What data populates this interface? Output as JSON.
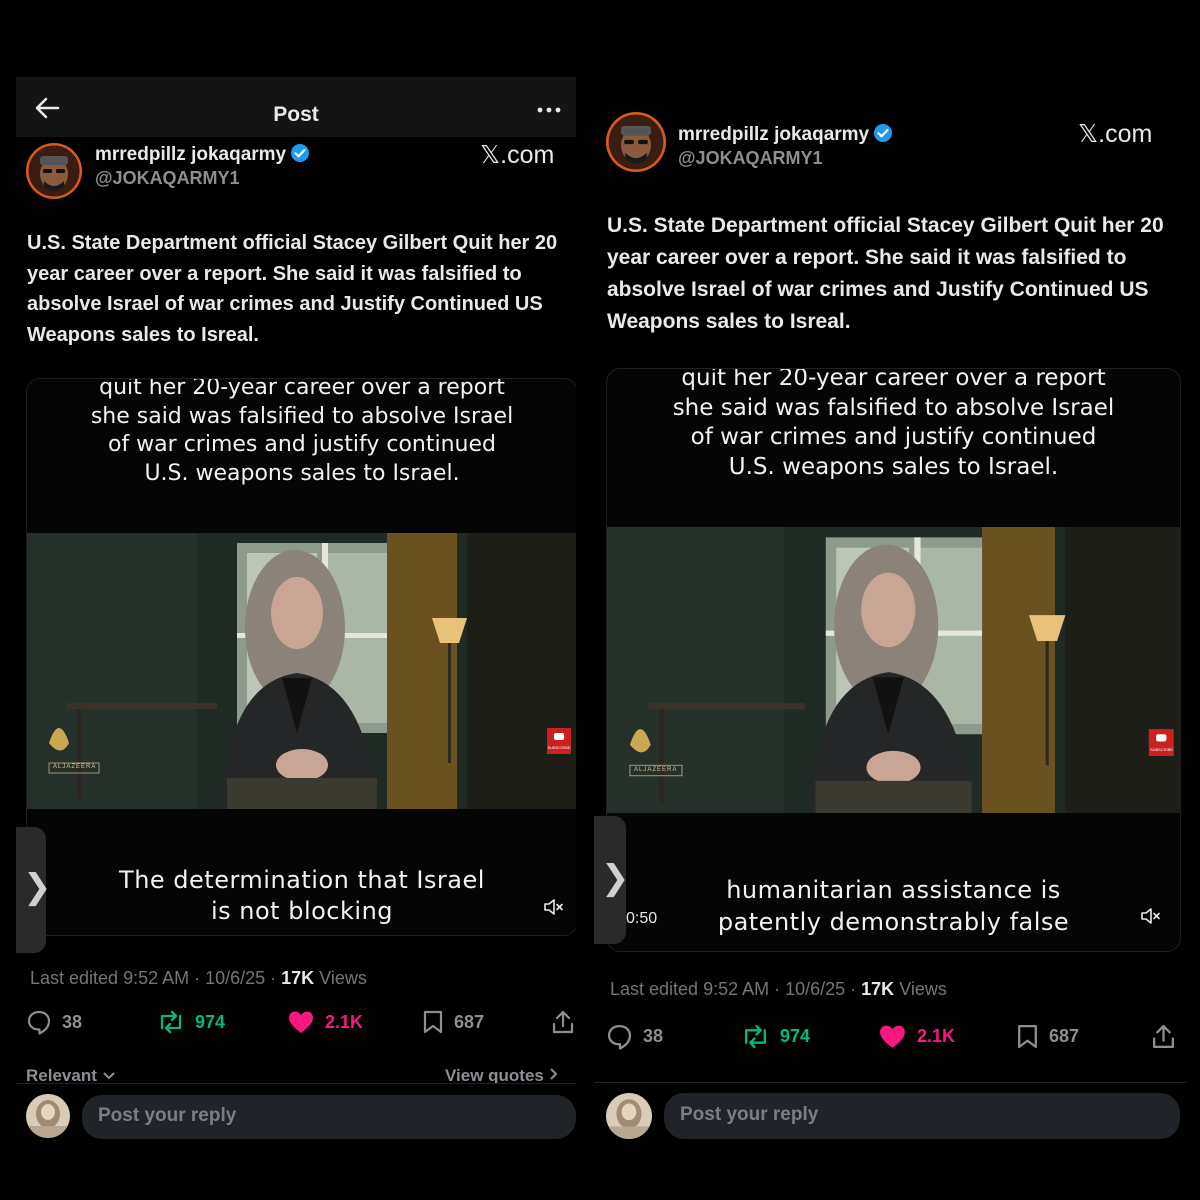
{
  "screens": [
    {
      "header": {
        "title": "Post"
      },
      "author": {
        "name": "mrredpillz jokaqarmy",
        "handle": "@JOKAQARMY1"
      },
      "source": "𝕏.com",
      "post_text": "U.S. State Department official Stacey Gilbert Quit her 20 year career over a report. She said it was falsified to absolve Israel of war crimes and Justify Continued US Weapons sales to Isreal.",
      "video": {
        "caption_top": [
          "quit her 20-year career over a report",
          "she said was falsified to absolve Israel",
          "of war crimes and justify continued",
          "U.S. weapons sales to Israel."
        ],
        "caption_bottom": [
          "The determination that Israel",
          "is not blocking"
        ],
        "brand": "ALJAZEERA",
        "subscribe": "SUBSCRIBE"
      },
      "meta": {
        "edited": "Last edited 9:52 AM · 10/6/25 · ",
        "views_count": "17K",
        "views_label": " Views"
      },
      "actions": {
        "replies": "38",
        "reposts": "974",
        "likes": "2.1K",
        "bookmarks": "687"
      },
      "links": {
        "relevant": "Relevant",
        "view_quotes": "View quotes"
      },
      "reply_placeholder": "Post your reply",
      "side_tab": "❯"
    },
    {
      "author": {
        "name": "mrredpillz jokaqarmy",
        "handle": "@JOKAQARMY1"
      },
      "source": "𝕏.com",
      "post_text": "U.S. State Department official Stacey Gilbert Quit her 20 year career over a report. She said it was falsified to absolve Israel of war crimes and Justify Continued US Weapons sales to Isreal.",
      "video": {
        "caption_top": [
          "quit her 20-year career over a report",
          "she said was falsified to absolve Israel",
          "of war crimes and justify continued",
          "U.S. weapons sales to Israel."
        ],
        "caption_bottom": [
          "humanitarian assistance is",
          "patently demonstrably false"
        ],
        "time": "0:50",
        "brand": "ALJAZEERA",
        "subscribe": "SUBSCRIBE"
      },
      "meta": {
        "edited": "Last edited 9:52 AM · 10/6/25 · ",
        "views_count": "17K",
        "views_label": " Views"
      },
      "actions": {
        "replies": "38",
        "reposts": "974",
        "likes": "2.1K",
        "bookmarks": "687"
      },
      "reply_placeholder": "Post your reply",
      "side_tab": "❯"
    }
  ],
  "colors": {
    "verified": "#1d9bf0",
    "repost": "#00ba7c",
    "like": "#f91880",
    "muted": "#71767b"
  },
  "icons": [
    "back-arrow-icon",
    "more-icon",
    "verified-icon",
    "mute-icon",
    "reply-icon",
    "repost-icon",
    "heart-icon",
    "bookmark-icon",
    "share-icon",
    "chevron-down-icon",
    "chevron-right-icon"
  ]
}
